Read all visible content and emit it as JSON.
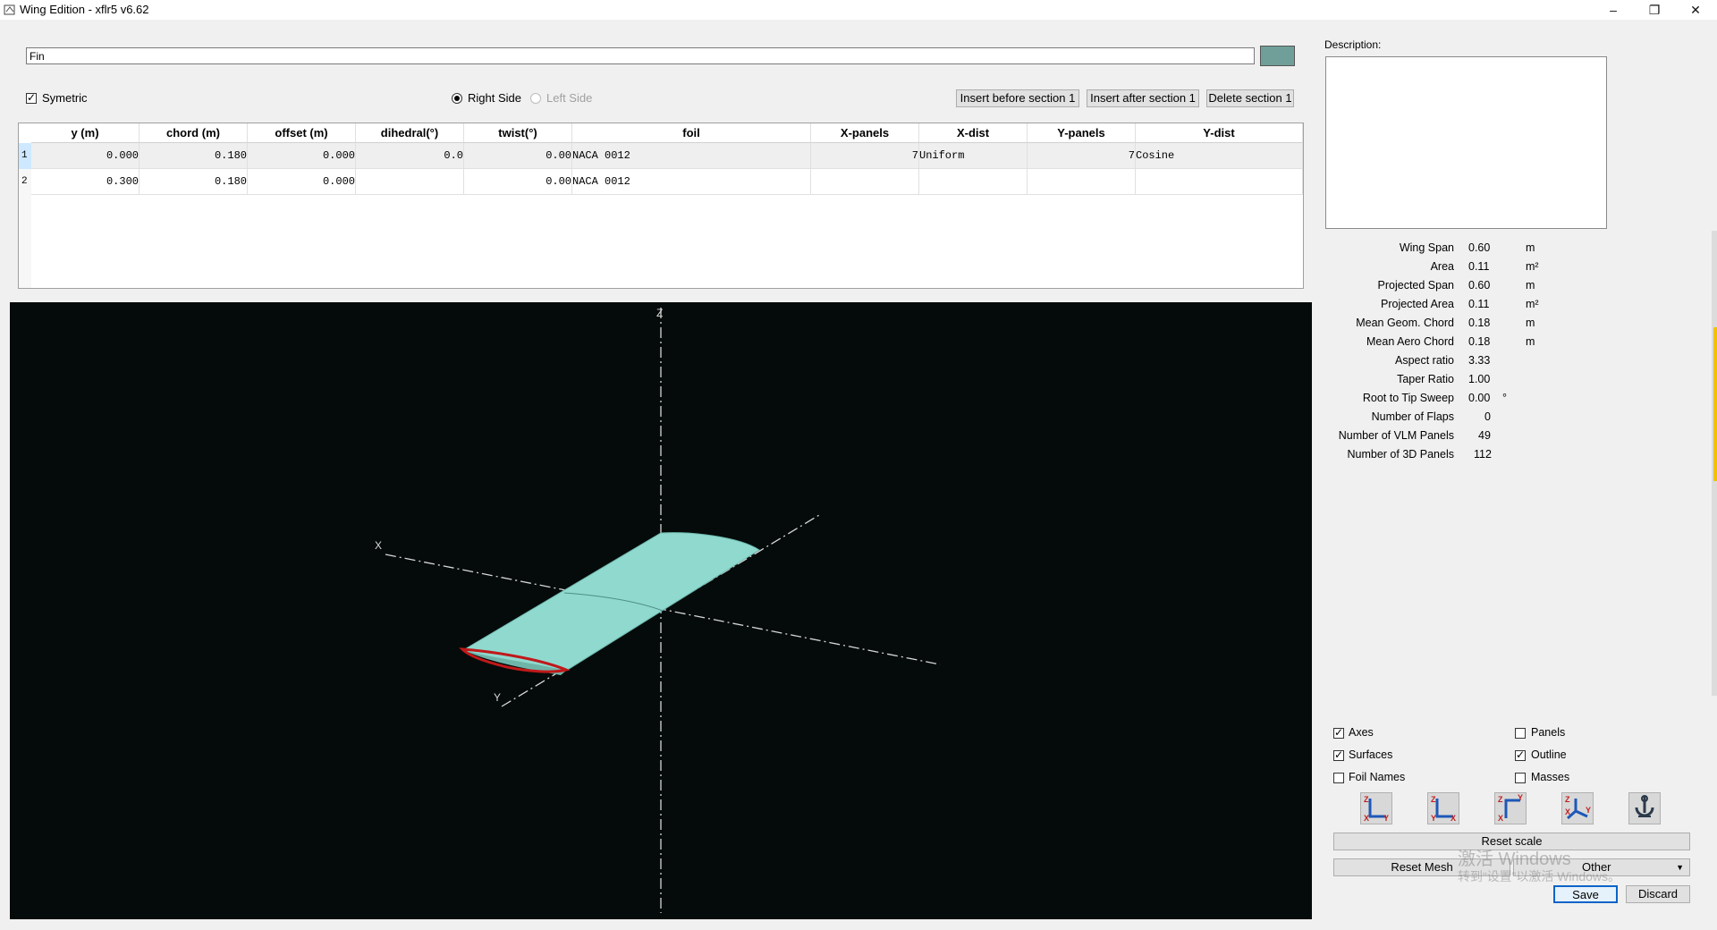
{
  "window": {
    "title": "Wing Edition - xflr5 v6.62",
    "minimize": "–",
    "restore": "❐",
    "close": "✕"
  },
  "wing": {
    "name": "Fin",
    "color": "#6f9f98",
    "symetric_label": "Symetric",
    "symetric_checked": true,
    "right_side_label": "Right Side",
    "left_side_label": "Left Side",
    "insert_before_label": "Insert before section 1",
    "insert_after_label": "Insert after section 1",
    "delete_label": "Delete section 1"
  },
  "table": {
    "headers": [
      "y (m)",
      "chord (m)",
      "offset (m)",
      "dihedral(°)",
      "twist(°)",
      "foil",
      "X-panels",
      "X-dist",
      "Y-panels",
      "Y-dist"
    ],
    "rows": [
      {
        "index": "1",
        "y": "0.000",
        "chord": "0.180",
        "offset": "0.000",
        "dihedral": "0.0",
        "twist": "0.00",
        "foil": "NACA 0012",
        "xpanels": "7",
        "xdist": "Uniform",
        "ypanels": "7",
        "ydist": "Cosine"
      },
      {
        "index": "2",
        "y": "0.300",
        "chord": "0.180",
        "offset": "0.000",
        "dihedral": "",
        "twist": "0.00",
        "foil": "NACA 0012",
        "xpanels": "",
        "xdist": "",
        "ypanels": "",
        "ydist": ""
      }
    ]
  },
  "view3d": {
    "axis_x": "X",
    "axis_y": "Y",
    "axis_z": "Z",
    "background": "#050b0a",
    "surface_color": "#8fd9cf",
    "outline_color": "#c0191a"
  },
  "description": {
    "label": "Description:",
    "text": ""
  },
  "properties": [
    {
      "label": "Wing Span",
      "value": "0.60",
      "unit": "m"
    },
    {
      "label": "Area",
      "value": "0.11",
      "unit": "m²"
    },
    {
      "label": "Projected Span",
      "value": "0.60",
      "unit": "m"
    },
    {
      "label": "Projected Area",
      "value": "0.11",
      "unit": "m²"
    },
    {
      "label": "Mean Geom. Chord",
      "value": "0.18",
      "unit": "m"
    },
    {
      "label": "Mean Aero Chord",
      "value": "0.18",
      "unit": "m"
    },
    {
      "label": "Aspect ratio",
      "value": "3.33",
      "unit": ""
    },
    {
      "label": "Taper Ratio",
      "value": "1.00",
      "unit": ""
    },
    {
      "label": "Root to Tip Sweep",
      "value": "0.00",
      "unit": "°"
    },
    {
      "label": "Number of Flaps",
      "value": "0",
      "unit": ""
    },
    {
      "label": "Number of VLM Panels",
      "value": "49",
      "unit": ""
    },
    {
      "label": "Number of 3D Panels",
      "value": "112",
      "unit": ""
    }
  ],
  "display_options": {
    "axes": {
      "label": "Axes",
      "checked": true
    },
    "surfaces": {
      "label": "Surfaces",
      "checked": true
    },
    "foil_names": {
      "label": "Foil Names",
      "checked": false
    },
    "panels": {
      "label": "Panels",
      "checked": false
    },
    "outline": {
      "label": "Outline",
      "checked": true
    },
    "masses": {
      "label": "Masses",
      "checked": false
    }
  },
  "view_buttons": [
    "front-view-icon",
    "side-view-icon",
    "top-view-icon",
    "iso-view-icon",
    "pick-center-icon"
  ],
  "buttons": {
    "reset_scale": "Reset scale",
    "reset_mesh": "Reset Mesh",
    "other": "Other",
    "save": "Save",
    "discard": "Discard"
  },
  "watermark": {
    "line1": "激活 Windows",
    "line2": "转到“设置”以激活 Windows。"
  }
}
